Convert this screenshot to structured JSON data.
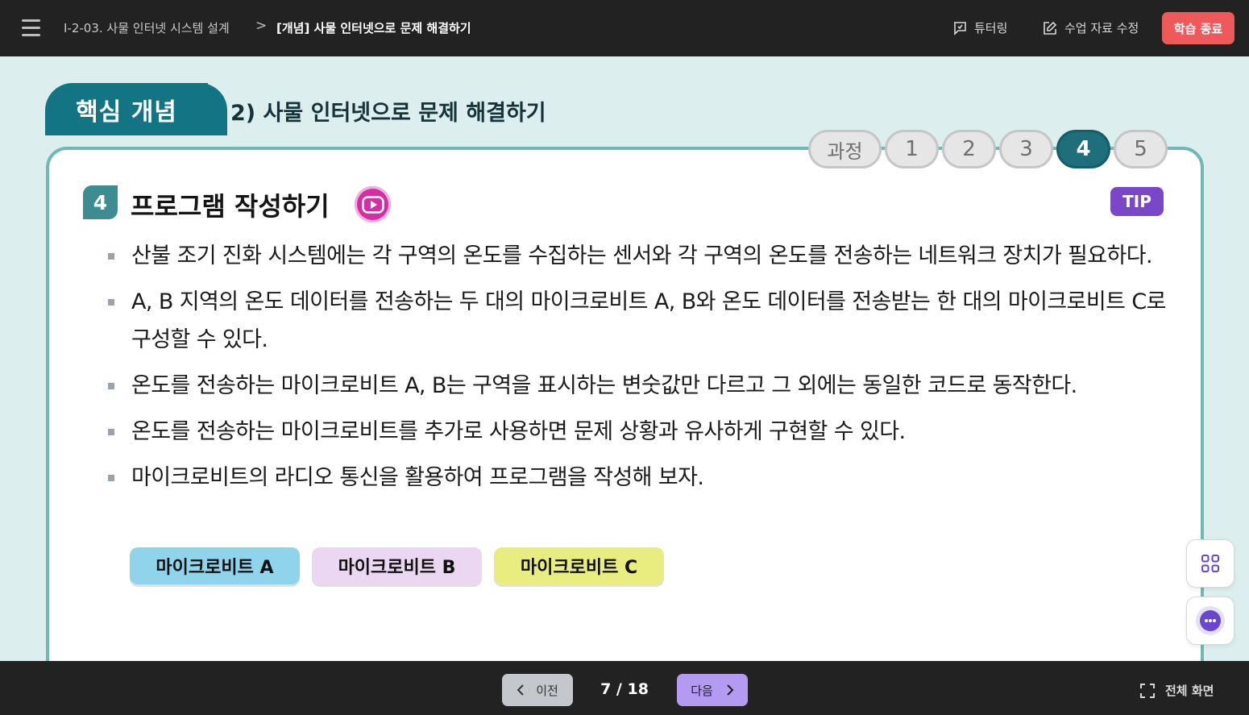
{
  "topbar": {
    "breadcrumb_course": "I-2-03. 사물 인터넷 시스템 설계",
    "breadcrumb_separator": ">",
    "breadcrumb_current": "[개념] 사물 인터넷으로 문제 해결하기",
    "tutoring_label": "튜터링",
    "edit_material_label": "수업 자료 수정",
    "end_label": "학습 종료"
  },
  "header": {
    "tab_label": "핵심 개념",
    "heading": "2) 사물 인터넷으로 문제 해결하기"
  },
  "steps": {
    "label": "과정",
    "items": [
      "1",
      "2",
      "3",
      "4",
      "5"
    ],
    "active": "4"
  },
  "section": {
    "number": "4",
    "title": "프로그램 작성하기",
    "tip_label": "TIP",
    "bullets": [
      "산불 조기 진화 시스템에는 각 구역의 온도를 수집하는 센서와 각 구역의 온도를 전송하는 네트워크 장치가 필요하다.",
      "A, B 지역의 온도 데이터를 전송하는 두 대의 마이크로비트 A, B와 온도 데이터를 전송받는 한 대의 마이크로비트 C로 구성할 수 있다.",
      "온도를 전송하는 마이크로비트 A, B는 구역을 표시하는 변숫값만 다르고 그 외에는 동일한 코드로 동작한다.",
      "온도를 전송하는 마이크로비트를 추가로 사용하면 문제 상황과 유사하게 구현할 수 있다.",
      "마이크로비트의 라디오 통신을 활용하여 프로그램을 작성해 보자."
    ],
    "pills": [
      "마이크로비트 A",
      "마이크로비트 B",
      "마이크로비트 C"
    ]
  },
  "bottombar": {
    "prev_label": "이전",
    "page_indicator": "7 / 18",
    "next_label": "다음",
    "fullscreen_label": "전체 화면"
  },
  "colors": {
    "topbar_bg": "#222222",
    "page_bg": "#dcefee",
    "accent_teal": "#137583",
    "end_button": "#ee5a5a",
    "tip_purple": "#7a47c8",
    "next_button": "#b59af2"
  }
}
